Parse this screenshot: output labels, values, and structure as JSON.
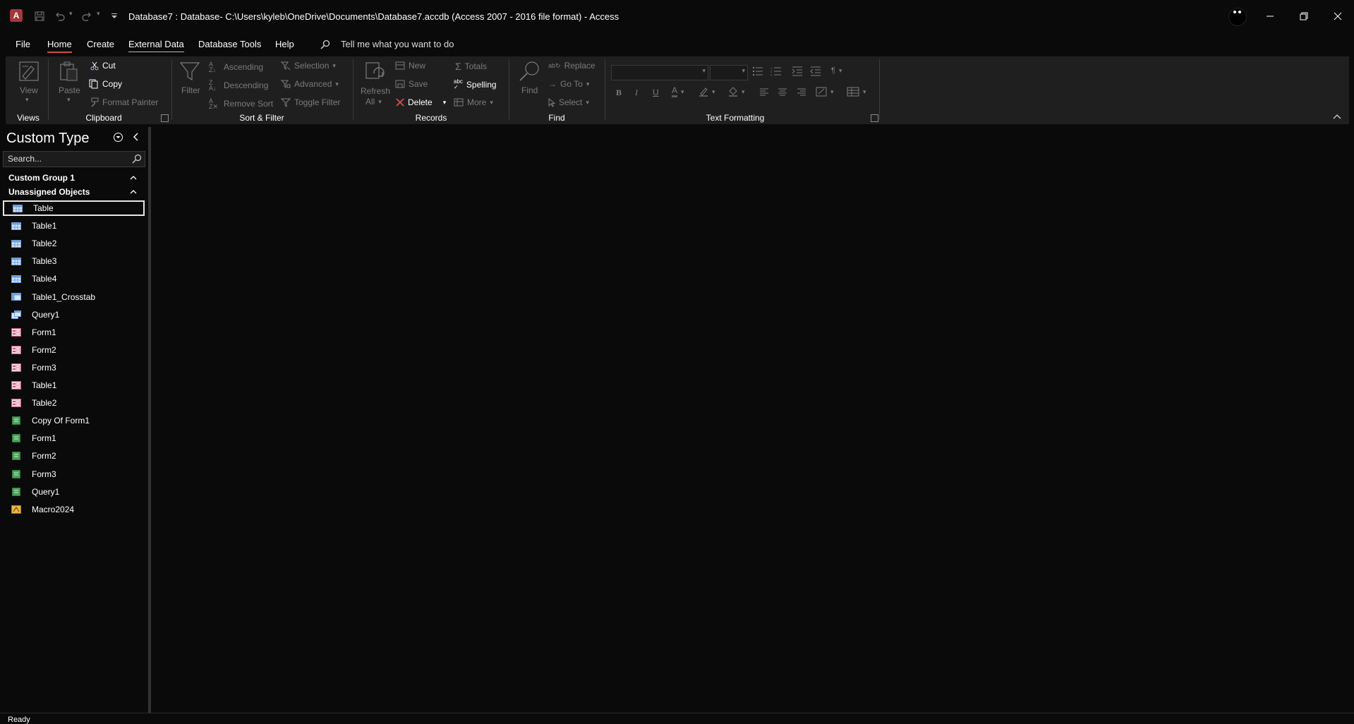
{
  "window": {
    "title": "Database7 : Database- C:\\Users\\kyleb\\OneDrive\\Documents\\Database7.accdb (Access 2007 - 2016 file format)  -  Access",
    "app_icon_letter": "A",
    "accent_color": "#a4373a"
  },
  "menu": {
    "tabs": [
      {
        "label": "File"
      },
      {
        "label": "Home"
      },
      {
        "label": "Create"
      },
      {
        "label": "External Data"
      },
      {
        "label": "Database Tools"
      },
      {
        "label": "Help"
      }
    ],
    "tell_me": "Tell me what you want to do"
  },
  "ribbon": {
    "views": {
      "view": "View",
      "label": "Views"
    },
    "clipboard": {
      "paste": "Paste",
      "cut": "Cut",
      "copy": "Copy",
      "format_painter": "Format Painter",
      "label": "Clipboard"
    },
    "sort_filter": {
      "filter": "Filter",
      "ascending": "Ascending",
      "descending": "Descending",
      "remove_sort": "Remove Sort",
      "selection": "Selection",
      "advanced": "Advanced",
      "toggle_filter": "Toggle Filter",
      "label": "Sort & Filter"
    },
    "records": {
      "refresh": "Refresh",
      "all": "All",
      "new": "New",
      "save": "Save",
      "delete": "Delete",
      "totals": "Totals",
      "spelling": "Spelling",
      "more": "More",
      "label": "Records"
    },
    "find": {
      "find": "Find",
      "replace": "Replace",
      "goto": "Go To",
      "select": "Select",
      "label": "Find"
    },
    "text_formatting": {
      "bold": "B",
      "italic": "I",
      "underline": "U",
      "font_color": "A",
      "label": "Text Formatting"
    }
  },
  "navpane": {
    "title": "Custom Type",
    "search_placeholder": "Search...",
    "groups": [
      {
        "label": "Custom Group 1"
      },
      {
        "label": "Unassigned Objects"
      }
    ],
    "items": [
      {
        "label": "Table",
        "icon": "table-icon"
      },
      {
        "label": "Table1",
        "icon": "table-icon"
      },
      {
        "label": "Table2",
        "icon": "table-icon"
      },
      {
        "label": "Table3",
        "icon": "table-icon"
      },
      {
        "label": "Table4",
        "icon": "table-icon"
      },
      {
        "label": "Table1_Crosstab",
        "icon": "crosstab-query-icon"
      },
      {
        "label": "Query1",
        "icon": "query-icon"
      },
      {
        "label": "Form1",
        "icon": "form-icon"
      },
      {
        "label": "Form2",
        "icon": "form-icon"
      },
      {
        "label": "Form3",
        "icon": "form-icon"
      },
      {
        "label": "Table1",
        "icon": "form-icon"
      },
      {
        "label": "Table2",
        "icon": "form-icon"
      },
      {
        "label": "Copy Of Form1",
        "icon": "report-icon"
      },
      {
        "label": "Form1",
        "icon": "report-icon"
      },
      {
        "label": "Form2",
        "icon": "report-icon"
      },
      {
        "label": "Form3",
        "icon": "report-icon"
      },
      {
        "label": "Query1",
        "icon": "report-icon"
      },
      {
        "label": "Macro2024",
        "icon": "macro-icon"
      }
    ]
  },
  "status": {
    "text": "Ready"
  }
}
